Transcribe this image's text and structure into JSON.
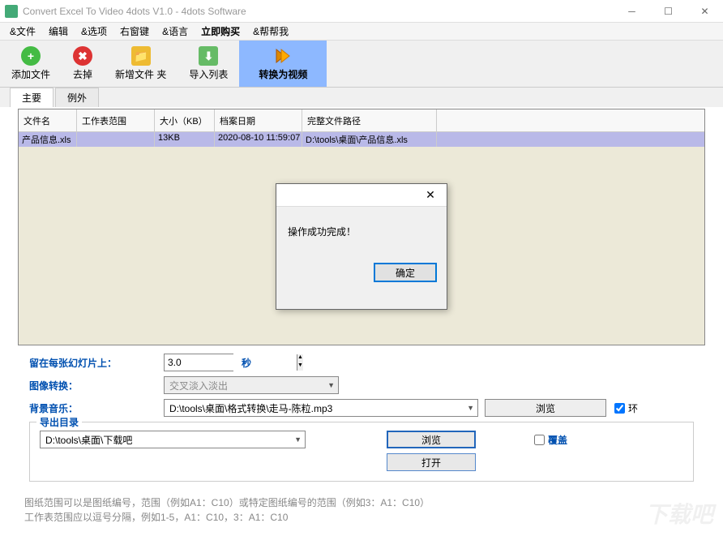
{
  "window": {
    "title": "Convert Excel To Video 4dots V1.0 - 4dots Software"
  },
  "menu": {
    "file": "&文件",
    "edit": "编辑",
    "options": "&选项",
    "rightkey": "右窗键",
    "lang": "&语言",
    "buy": "立即购买",
    "help": "&帮帮我"
  },
  "toolbar": {
    "add": "添加文件",
    "remove": "去掉",
    "newfile": "新增文件 夹",
    "import": "导入列表",
    "convert": "转换为视频"
  },
  "tabs": {
    "main": "主要",
    "except": "例外"
  },
  "table": {
    "headers": {
      "name": "文件名",
      "range": "工作表范围",
      "size": "大小（KB）",
      "date": "档案日期",
      "path": "完整文件路径"
    },
    "rows": [
      {
        "name": "产品信息.xls",
        "range": "",
        "size": "13KB",
        "date": "2020-08-10 11:59:07",
        "path": "D:\\tools\\桌面\\产品信息.xls"
      }
    ]
  },
  "dialog": {
    "message": "操作成功完成！",
    "ok": "确定"
  },
  "options": {
    "stay_label": "留在每张幻灯片上：",
    "stay_value": "3.0",
    "stay_unit": "秒",
    "transition_label": "图像转换：",
    "transition_value": "交叉淡入淡出",
    "bgm_label": "背景音乐：",
    "bgm_value": "D:\\tools\\桌面\\格式转换\\走马-陈粒.mp3",
    "browse": "浏览",
    "ring": "环"
  },
  "export": {
    "legend": "导出目录",
    "path": "D:\\tools\\桌面\\下载吧",
    "browse": "浏览",
    "open": "打开",
    "overwrite": "覆盖"
  },
  "hint": {
    "line1": "图纸范围可以是图纸编号，范围（例如A1：C10）或特定图纸编号的范围（例如3：A1：C10）",
    "line2": "工作表范围应以逗号分隔，例如1-5，A1：C10，3：A1：C10"
  },
  "watermark": "下载吧"
}
